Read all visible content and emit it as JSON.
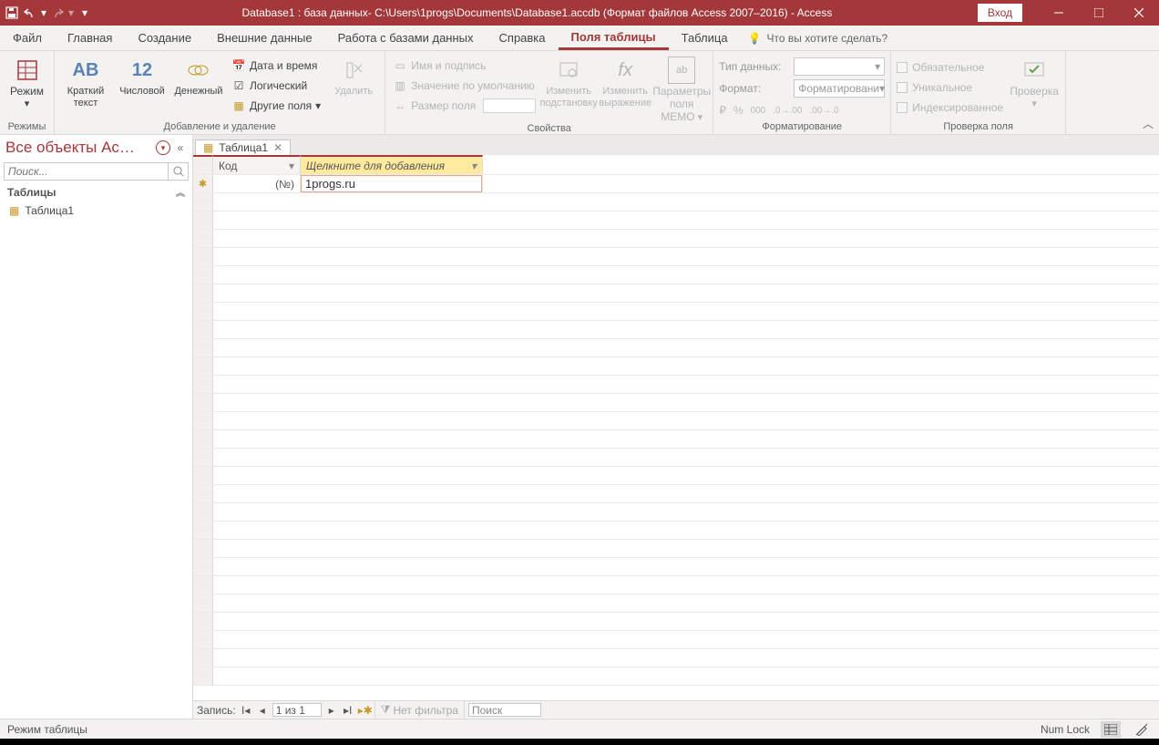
{
  "titlebar": {
    "title": "Database1 : база данных- C:\\Users\\1progs\\Documents\\Database1.accdb (Формат файлов Access 2007–2016)  -  Access",
    "signin": "Вход"
  },
  "tabs": {
    "file": "Файл",
    "home": "Главная",
    "create": "Создание",
    "external": "Внешние данные",
    "dbtools": "Работа с базами данных",
    "help": "Справка",
    "fields": "Поля таблицы",
    "table": "Таблица",
    "tellme": "Что вы хотите сделать?"
  },
  "ribbon": {
    "groups": {
      "views": "Режимы",
      "addrem": "Добавление и удаление",
      "props": "Свойства",
      "format": "Форматирование",
      "valid": "Проверка поля"
    },
    "views_btn": "Режим",
    "short_text": "Краткий текст",
    "number": "Числовой",
    "currency": "Денежный",
    "datetime": "Дата и время",
    "yesno": "Логический",
    "morefields": "Другие поля",
    "delete": "Удалить",
    "name_caption": "Имя и подпись",
    "default_val": "Значение по умолчанию",
    "field_size_lbl": "Размер поля",
    "lookup": "Изменить подстановку",
    "expr": "Изменить выражение",
    "memo": "Параметры поля MEMO",
    "datatype_lbl": "Тип данных:",
    "format_lbl": "Формат:",
    "format_ctl": "Форматировани",
    "required": "Обязательное",
    "unique": "Уникальное",
    "indexed": "Индексированное",
    "validation": "Проверка"
  },
  "navpane": {
    "title": "Все объекты Ac…",
    "search_ph": "Поиск...",
    "group": "Таблицы",
    "item1": "Таблица1"
  },
  "sheet": {
    "tab": "Таблица1",
    "col1": "Код",
    "col2": "Щелкните для добавления",
    "row1_id": "(№)",
    "row1_edit": "1progs.ru"
  },
  "recnav": {
    "label": "Запись:",
    "pos": "1 из 1",
    "nofilter": "Нет фильтра",
    "search": "Поиск"
  },
  "status": {
    "mode": "Режим таблицы",
    "numlock": "Num Lock"
  }
}
